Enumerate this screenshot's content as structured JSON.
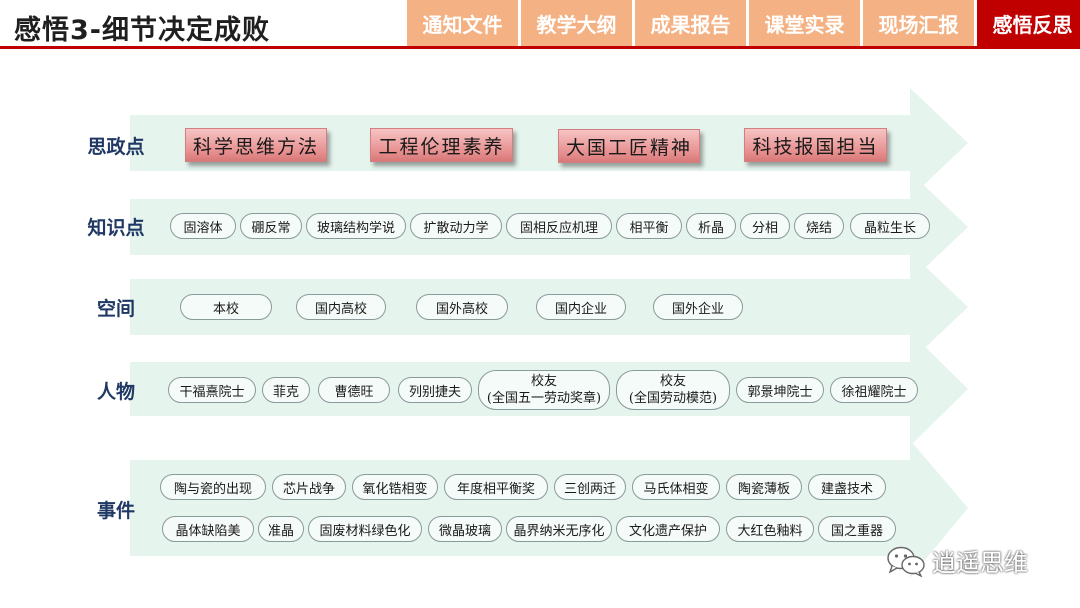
{
  "header": {
    "title": "感悟3-细节决定成败",
    "tabs": [
      {
        "label": "通知文件",
        "active": false
      },
      {
        "label": "教学大纲",
        "active": false
      },
      {
        "label": "成果报告",
        "active": false
      },
      {
        "label": "课堂实录",
        "active": false
      },
      {
        "label": "现场汇报",
        "active": false
      },
      {
        "label": "感悟反思",
        "active": true
      }
    ]
  },
  "colors": {
    "accent": "#c00000",
    "tab": "#f4b183",
    "arrow": "#e6f4ee",
    "label": "#1f3864"
  },
  "rows": {
    "sizheng": {
      "label": "思政点",
      "items": [
        "科学思维方法",
        "工程伦理素养",
        "大国工匠精神",
        "科技报国担当"
      ]
    },
    "zhishi": {
      "label": "知识点",
      "items": [
        "固溶体",
        "硼反常",
        "玻璃结构学说",
        "扩散动力学",
        "固相反应机理",
        "相平衡",
        "析晶",
        "分相",
        "烧结",
        "晶粒生长"
      ]
    },
    "kongjian": {
      "label": "空间",
      "items": [
        "本校",
        "国内高校",
        "国外高校",
        "国内企业",
        "国外企业"
      ]
    },
    "renwu": {
      "label": "人物",
      "items": [
        "干福熹院士",
        "菲克",
        "曹德旺",
        "列别捷夫"
      ],
      "tall_items": [
        {
          "line1": "校友",
          "line2": "(全国五一劳动奖章)"
        },
        {
          "line1": "校友",
          "line2": "(全国劳动模范)"
        }
      ],
      "items_after": [
        "郭景坤院士",
        "徐祖耀院士"
      ]
    },
    "shijian": {
      "label": "事件",
      "items_row1": [
        "陶与瓷的出现",
        "芯片战争",
        "氧化锆相变",
        "年度相平衡奖",
        "三创两迁",
        "马氏体相变",
        "陶瓷薄板",
        "建盏技术"
      ],
      "items_row2": [
        "晶体缺陷美",
        "准晶",
        "固废材料绿色化",
        "微晶玻璃",
        "晶界纳米无序化",
        "文化遗产保护",
        "大红色釉料",
        "国之重器"
      ]
    }
  },
  "watermark": {
    "text": "逍遥思维",
    "icon": "wechat-icon"
  }
}
